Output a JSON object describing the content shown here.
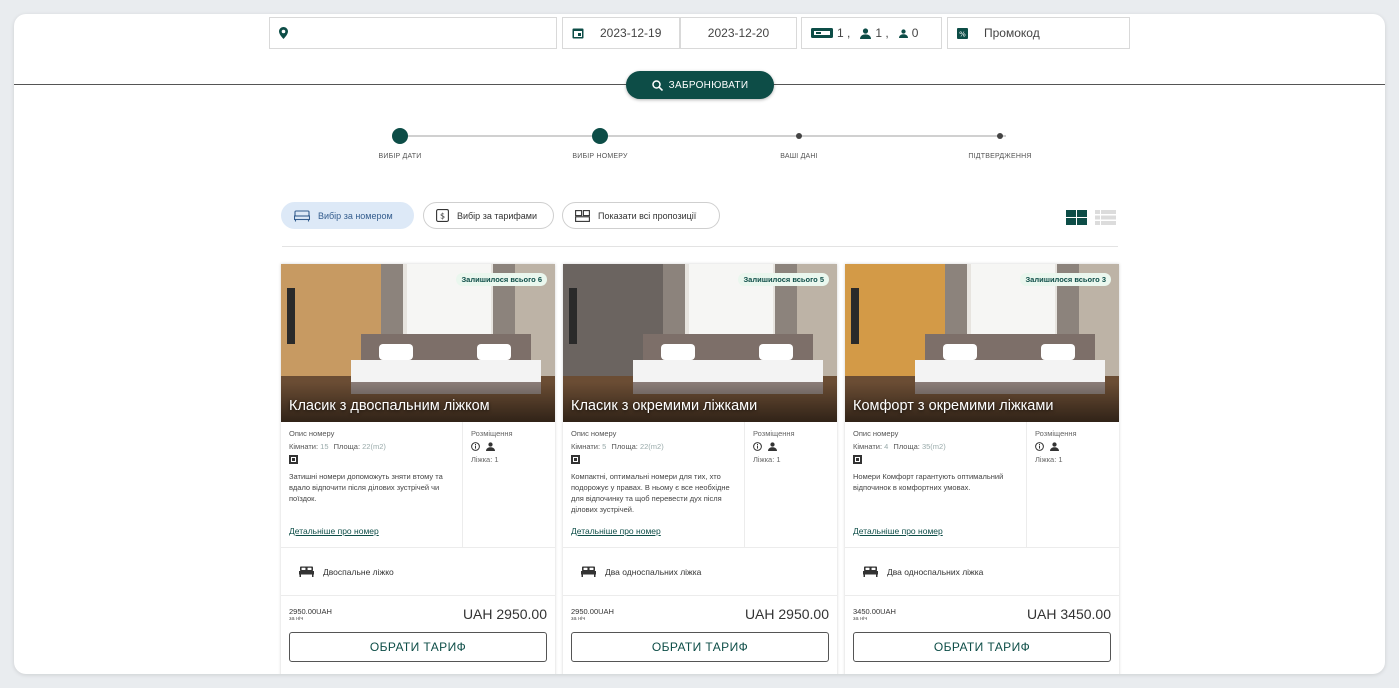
{
  "search": {
    "location_value": "",
    "date_from": "2023-12-19",
    "date_to": "2023-12-20",
    "rooms_count": "1 ,",
    "adults_count": "1 ,",
    "children_count": "0",
    "promo_placeholder": "Промокод",
    "book_button": "ЗАБРОНЮВАТИ"
  },
  "steps": [
    {
      "label": "ВИБІР ДАТИ",
      "state": "done"
    },
    {
      "label": "ВИБІР НОМЕРУ",
      "state": "active"
    },
    {
      "label": "ВАШІ ДАНІ",
      "state": "pending"
    },
    {
      "label": "ПІДТВЕРДЖЕННЯ",
      "state": "pending"
    }
  ],
  "filters": [
    {
      "label": "Вибір за номером",
      "active": true
    },
    {
      "label": "Вибір за тарифами",
      "active": false
    },
    {
      "label": "Показати всі пропозиції",
      "active": false
    }
  ],
  "view_toggle": {
    "grid_icon": "grid-view-icon",
    "list_icon": "list-view-icon"
  },
  "labels": {
    "room_desc": "Опис номеру",
    "rooms": "Кімнати:",
    "area": "Площа:",
    "placement": "Розміщення",
    "beds": "Ліжка:",
    "more": "Детальніше про номер",
    "per_night": "за ніч",
    "choose": "ОБРАТИ ТАРИФ"
  },
  "rooms": [
    {
      "badge": "Залишилося всього 6",
      "title": "Класик з двоспальним ліжком",
      "rooms_value": "15",
      "area_value": "22(m2)",
      "beds_value": "1",
      "description": "Затишні номери допоможуть зняти втому та вдало відпочити після ділових зустрічей чи поїздок.",
      "bed_type": "Двоспальне ліжко",
      "price_small": "2950.00UAH",
      "price_big": "UAH 2950.00",
      "wall_color": "#c79a62"
    },
    {
      "badge": "Залишилося всього 5",
      "title": "Класик з окремими ліжками",
      "rooms_value": "5",
      "area_value": "22(m2)",
      "beds_value": "1",
      "description": "Компактні, оптимальні номери для тих, хто подорожує у правах. В ньому є все необхідне для відпочинку та щоб перевести дух після ділових зустрічей.",
      "bed_type": "Два односпальних ліжка",
      "price_small": "2950.00UAH",
      "price_big": "UAH 2950.00",
      "wall_color": "#6b6460"
    },
    {
      "badge": "Залишилося всього 3",
      "title": "Комфорт з окремими ліжками",
      "rooms_value": "4",
      "area_value": "35(m2)",
      "beds_value": "1",
      "description": "Номери Комфорт гарантують оптимальний відпочинок в комфортних умовах.",
      "bed_type": "Два односпальних ліжка",
      "price_small": "3450.00UAH",
      "price_big": "UAH 3450.00",
      "wall_color": "#d39a47"
    }
  ],
  "colors": {
    "primary": "#0d4d47",
    "pill_active_bg": "#dde9f7"
  }
}
